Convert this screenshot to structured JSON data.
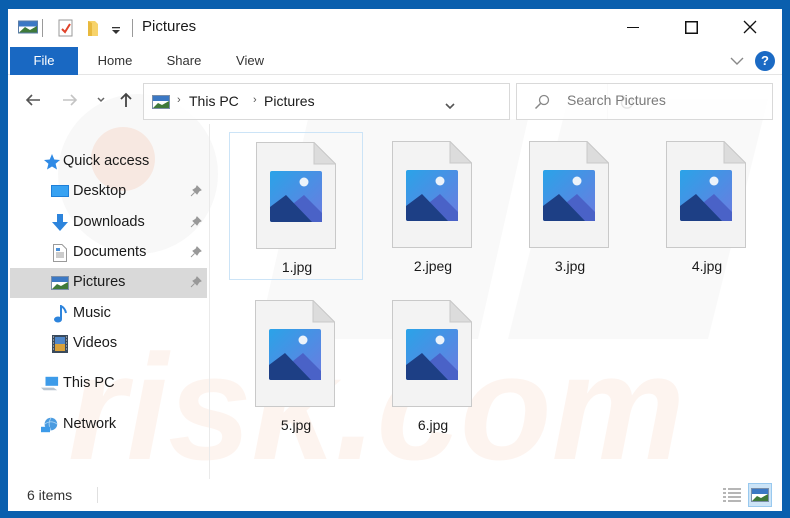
{
  "window": {
    "title": "Pictures",
    "controls": {
      "minimize": "minimize",
      "maximize": "maximize",
      "close": "close"
    }
  },
  "quick_access_toolbar": {
    "icons": [
      "pictures-folder-icon",
      "properties-icon",
      "new-folder-icon",
      "customize-dropdown-icon"
    ]
  },
  "ribbon": {
    "tabs": [
      {
        "label": "File",
        "active": true
      },
      {
        "label": "Home"
      },
      {
        "label": "Share"
      },
      {
        "label": "View"
      }
    ],
    "help_label": "?"
  },
  "navigation": {
    "breadcrumb": [
      "This PC",
      "Pictures"
    ],
    "search_placeholder": "Search Pictures"
  },
  "sidebar": {
    "items": [
      {
        "label": "Quick access",
        "icon": "star-icon",
        "pinned": false
      },
      {
        "label": "Desktop",
        "icon": "desktop-icon",
        "pinned": true
      },
      {
        "label": "Downloads",
        "icon": "download-icon",
        "pinned": true
      },
      {
        "label": "Documents",
        "icon": "documents-icon",
        "pinned": true
      },
      {
        "label": "Pictures",
        "icon": "pictures-icon",
        "pinned": true,
        "selected": true
      },
      {
        "label": "Music",
        "icon": "music-icon",
        "pinned": false
      },
      {
        "label": "Videos",
        "icon": "videos-icon",
        "pinned": false
      },
      {
        "label": "This PC",
        "icon": "computer-icon",
        "pinned": false
      },
      {
        "label": "Network",
        "icon": "network-icon",
        "pinned": false
      }
    ]
  },
  "files": [
    {
      "name": "1.jpg",
      "selected": true
    },
    {
      "name": "2.jpeg"
    },
    {
      "name": "3.jpg"
    },
    {
      "name": "4.jpg"
    },
    {
      "name": "5.jpg"
    },
    {
      "name": "6.jpg"
    }
  ],
  "status": {
    "item_count": "6 items",
    "active_view": "large-icons"
  },
  "colors": {
    "accent": "#1968c2",
    "frame": "#0a5fae",
    "selection": "#d9d9d9"
  }
}
